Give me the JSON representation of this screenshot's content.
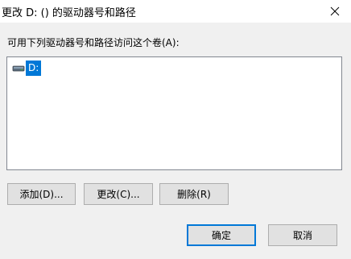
{
  "window": {
    "title": "更改 D: () 的驱动器号和路径",
    "close_icon": "close-icon"
  },
  "content": {
    "instruction": "可用下列驱动器号和路径访问这个卷(A):"
  },
  "list": {
    "items": [
      {
        "label": "D:",
        "icon": "drive-icon",
        "selected": true
      }
    ]
  },
  "buttons": {
    "add": "添加(D)...",
    "change": "更改(C)...",
    "remove": "删除(R)",
    "ok": "确定",
    "cancel": "取消"
  },
  "colors": {
    "selection": "#0078d7",
    "default_button_border": "#0078d7"
  }
}
